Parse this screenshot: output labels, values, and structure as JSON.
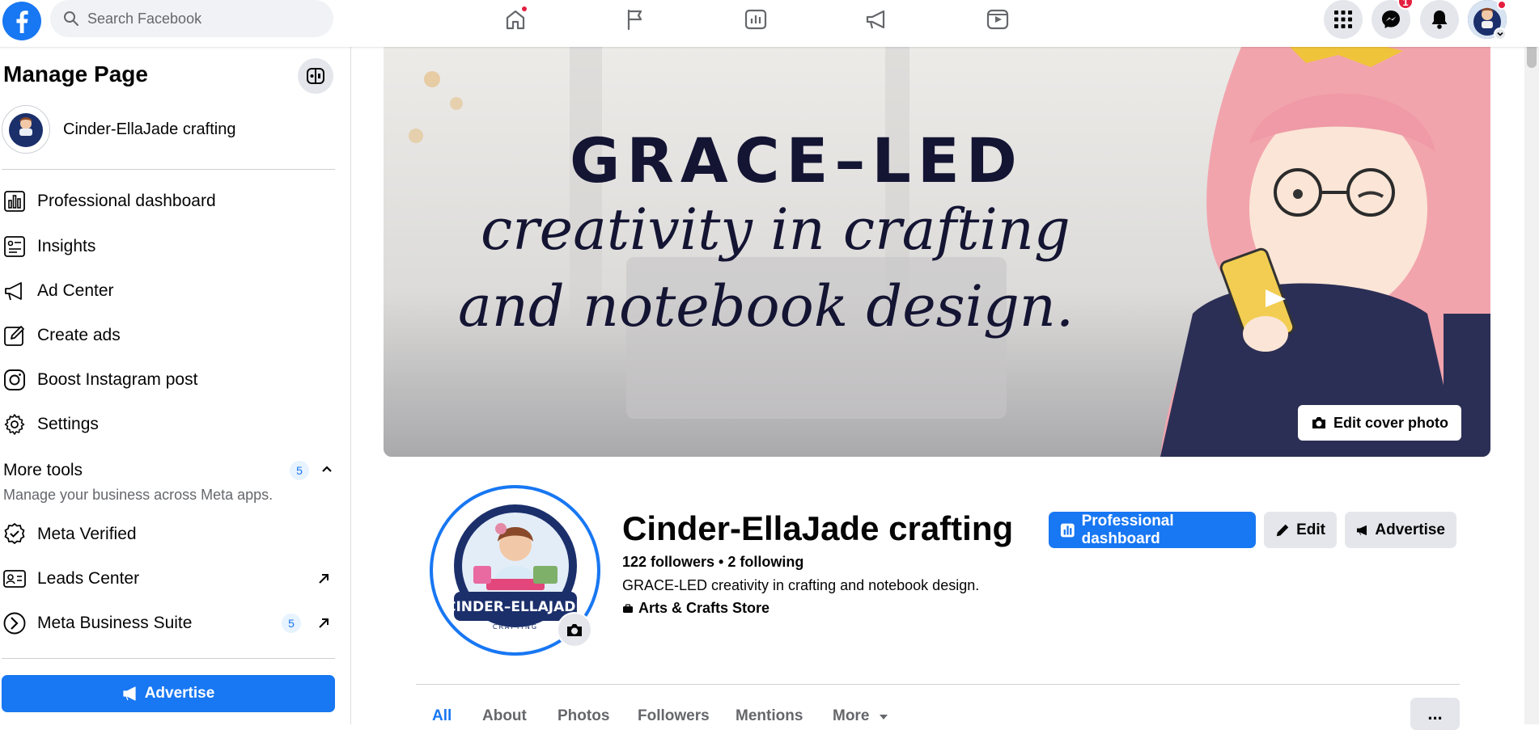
{
  "topbar": {
    "search_placeholder": "Search Facebook",
    "messenger_badge": "1",
    "nav_icons": [
      "home-icon",
      "flag-icon",
      "insights-icon",
      "megaphone-icon",
      "video-icon"
    ],
    "brand_color": "#1877f2"
  },
  "sidebar": {
    "title": "Manage Page",
    "page_name": "Cinder-EllaJade crafting",
    "items": [
      {
        "label": "Professional dashboard",
        "icon": "chart-icon"
      },
      {
        "label": "Insights",
        "icon": "insights-icon"
      },
      {
        "label": "Ad Center",
        "icon": "megaphone-icon"
      },
      {
        "label": "Create ads",
        "icon": "pencil-icon"
      },
      {
        "label": "Boost Instagram post",
        "icon": "instagram-icon"
      },
      {
        "label": "Settings",
        "icon": "gear-icon"
      }
    ],
    "more_tools": {
      "title": "More tools",
      "count": "5",
      "subtitle": "Manage your business across Meta apps."
    },
    "tools": [
      {
        "label": "Meta Verified",
        "icon": "verified-icon"
      },
      {
        "label": "Leads Center",
        "icon": "contact-card-icon"
      },
      {
        "label": "Meta Business Suite",
        "icon": "business-suite-icon",
        "count": "5"
      }
    ],
    "advertise_label": "Advertise"
  },
  "cover": {
    "line1": "GRACE–LED",
    "line2": "creativity in crafting",
    "line3": "and notebook design.",
    "edit_label": "Edit cover photo"
  },
  "profile": {
    "avatar_text": "CINDER–ELLAJADE",
    "avatar_subtext": "CRAFTING",
    "name": "Cinder-EllaJade crafting",
    "followers": "122 followers • 2 following",
    "bio": "GRACE-LED creativity in crafting and notebook design.",
    "category": "Arts & Crafts Store"
  },
  "actions": {
    "dashboard_label": "Professional dashboard",
    "edit_label": "Edit",
    "advertise_label": "Advertise"
  },
  "tabs": [
    {
      "label": "All",
      "active": true
    },
    {
      "label": "About"
    },
    {
      "label": "Photos"
    },
    {
      "label": "Followers"
    },
    {
      "label": "Mentions"
    },
    {
      "label": "More"
    }
  ],
  "tabs_more_label": "..."
}
